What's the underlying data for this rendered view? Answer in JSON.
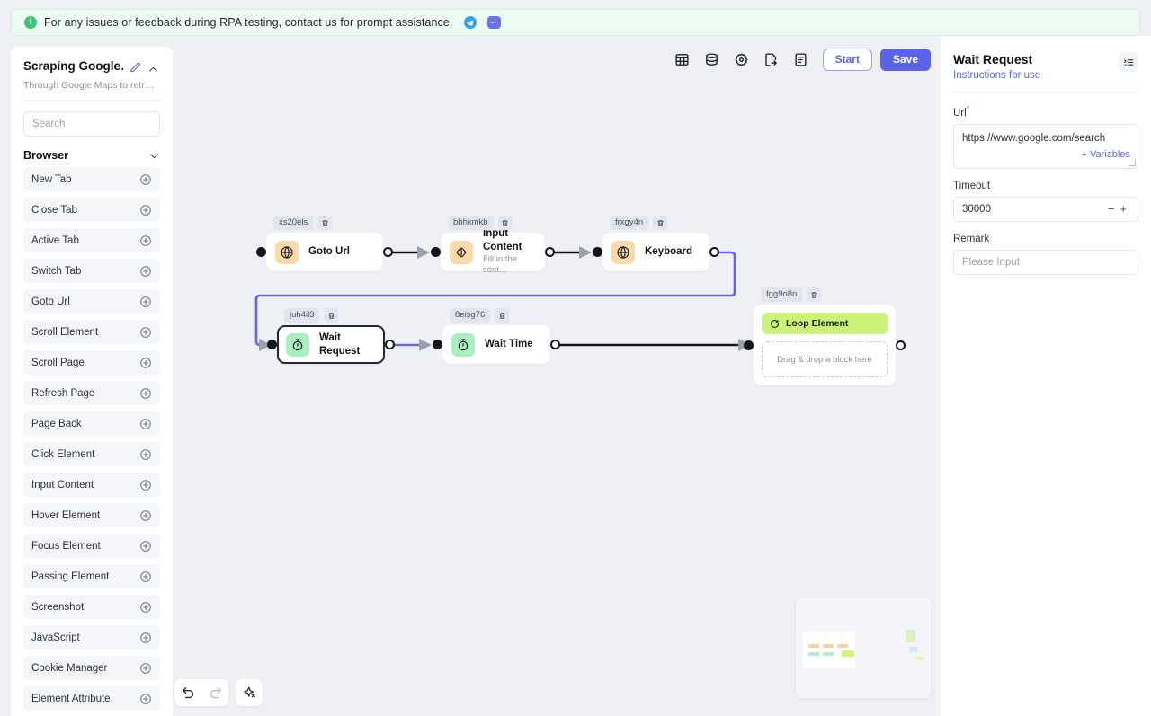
{
  "banner": {
    "icon": "info-icon",
    "text": "For any issues or feedback during RPA testing, contact us for prompt assistance.",
    "telegram_icon": "telegram-icon",
    "discord_icon": "discord-icon"
  },
  "sidebar": {
    "title": "Scraping Google…",
    "subtitle": "Through Google Maps to retr…",
    "edit_icon": "pencil-icon",
    "collapse_icon": "chevron-up-icon",
    "search": {
      "value": "",
      "placeholder": "Search"
    },
    "group": {
      "label": "Browser",
      "chevron_icon": "chevron-down-icon"
    },
    "items": [
      {
        "label": "New Tab",
        "add_icon": "plus-circle-icon"
      },
      {
        "label": "Close Tab",
        "add_icon": "plus-circle-icon"
      },
      {
        "label": "Active Tab",
        "add_icon": "plus-circle-icon"
      },
      {
        "label": "Switch Tab",
        "add_icon": "plus-circle-icon"
      },
      {
        "label": "Goto Url",
        "add_icon": "plus-circle-icon"
      },
      {
        "label": "Scroll Element",
        "add_icon": "plus-circle-icon"
      },
      {
        "label": "Scroll Page",
        "add_icon": "plus-circle-icon"
      },
      {
        "label": "Refresh Page",
        "add_icon": "plus-circle-icon"
      },
      {
        "label": "Page Back",
        "add_icon": "plus-circle-icon"
      },
      {
        "label": "Click Element",
        "add_icon": "plus-circle-icon"
      },
      {
        "label": "Input Content",
        "add_icon": "plus-circle-icon"
      },
      {
        "label": "Hover Element",
        "add_icon": "plus-circle-icon"
      },
      {
        "label": "Focus Element",
        "add_icon": "plus-circle-icon"
      },
      {
        "label": "Passing Element",
        "add_icon": "plus-circle-icon"
      },
      {
        "label": "Screenshot",
        "add_icon": "plus-circle-icon"
      },
      {
        "label": "JavaScript",
        "add_icon": "plus-circle-icon"
      },
      {
        "label": "Cookie Manager",
        "add_icon": "plus-circle-icon"
      },
      {
        "label": "Element Attribute",
        "add_icon": "plus-circle-icon"
      }
    ]
  },
  "toolbar": {
    "buttons": [
      {
        "name": "table-icon"
      },
      {
        "name": "database-icon"
      },
      {
        "name": "gear-icon"
      },
      {
        "name": "export-file-icon"
      },
      {
        "name": "document-icon"
      }
    ],
    "start_label": "Start",
    "save_label": "Save"
  },
  "canvas": {
    "nodes": [
      {
        "id": "xs20els",
        "title": "Goto Url",
        "desc": "",
        "icon": "globe-icon",
        "icon_color": "#fcd9ab",
        "selected": false
      },
      {
        "id": "bbhkmkb",
        "title": "Input Content",
        "desc": "Fill in the cont…",
        "icon": "input-cursor-icon",
        "icon_color": "#fcd9ab",
        "selected": false
      },
      {
        "id": "frxgy4n",
        "title": "Keyboard",
        "desc": "",
        "icon": "globe-icon",
        "icon_color": "#fcd9ab",
        "selected": false
      },
      {
        "id": "juh4il3",
        "title": "Wait Request",
        "desc": "",
        "icon": "stopwatch-icon",
        "icon_color": "#abefc0",
        "selected": true
      },
      {
        "id": "8eisg76",
        "title": "Wait Time",
        "desc": "",
        "icon": "stopwatch-icon",
        "icon_color": "#abefc0",
        "selected": false
      }
    ],
    "loop_node": {
      "id": "fgg9o8n",
      "title": "Loop Element",
      "icon": "loop-icon",
      "header_color": "#ccf279",
      "dropzone_text": "Drag & drop a block here"
    },
    "delete_icon": "trash-icon",
    "bottom_tools": [
      {
        "name": "undo-icon"
      },
      {
        "name": "redo-icon"
      },
      {
        "name": "auto-layout-icon"
      }
    ],
    "minimap": {
      "name": "minimap"
    }
  },
  "right_panel": {
    "title": "Wait Request",
    "instructions_label": "Instructions for use",
    "list_icon": "list-settings-icon",
    "url": {
      "label": "Url",
      "required": "*",
      "value": "https://www.google.com/search",
      "variables_label": "+ Variables"
    },
    "timeout": {
      "label": "Timeout",
      "value": "30000",
      "minus": "−",
      "plus": "+"
    },
    "remark": {
      "label": "Remark",
      "value": "",
      "placeholder": "Please Input"
    }
  },
  "colors": {
    "accent": "#5b63e8",
    "banner_bg": "#eefbf2",
    "canvas_bg": "#eef0f5",
    "node_orange": "#fcd9ab",
    "node_green": "#abefc0",
    "loop_green": "#ccf279",
    "edge_active": "#6a61e8",
    "edge_default": "#12141a"
  }
}
